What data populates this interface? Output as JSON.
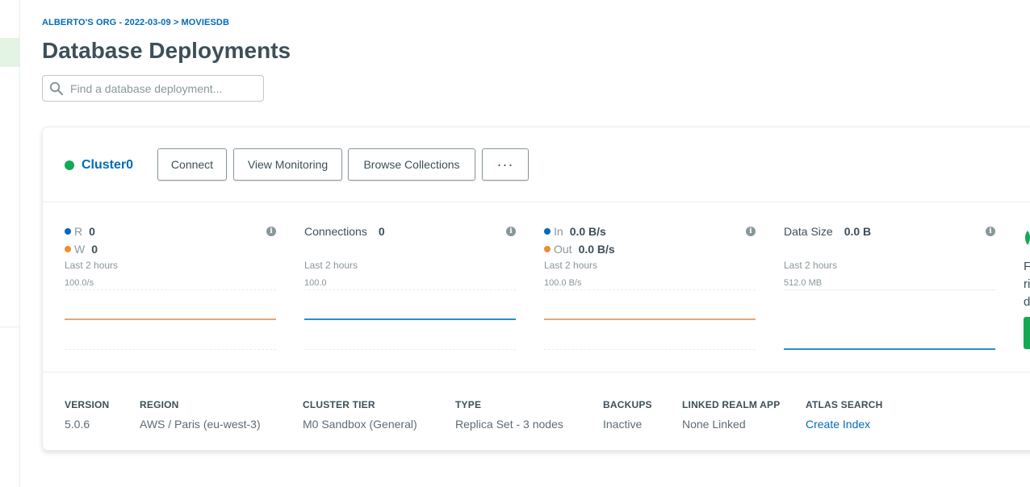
{
  "breadcrumb": "ALBERTO'S ORG - 2022-03-09 > MOVIESDB",
  "page_title": "Database Deployments",
  "search": {
    "placeholder": "Find a database deployment..."
  },
  "cluster": {
    "name": "Cluster0",
    "status_color": "#13aa52",
    "buttons": {
      "connect": "Connect",
      "view_monitoring": "View Monitoring",
      "browse_collections": "Browse Collections",
      "more": "···"
    }
  },
  "metrics": {
    "rw": {
      "r_label": "R",
      "r_value": "0",
      "r_color": "#016bb8",
      "w_label": "W",
      "w_value": "0",
      "w_color": "#f28b2c",
      "period": "Last 2 hours",
      "scale": "100.0/s",
      "line_color": "#e1a87a"
    },
    "connections": {
      "title": "Connections",
      "value": "0",
      "period": "Last 2 hours",
      "scale": "100.0",
      "line_color": "#2a8fbf"
    },
    "network": {
      "in_label": "In",
      "in_value": "0.0 B/s",
      "in_color": "#016bb8",
      "out_label": "Out",
      "out_value": "0.0 B/s",
      "out_color": "#f28b2c",
      "period": "Last 2 hours",
      "scale": "100.0 B/s",
      "line_color": "#e1a87a"
    },
    "data_size": {
      "title": "Data Size",
      "value": "0.0 B",
      "period": "Last 2 hours",
      "scale": "512.0 MB",
      "line_color": "#2a8fbf"
    },
    "info_icon": "info-icon"
  },
  "details": [
    {
      "label": "VERSION",
      "value": "5.0.6"
    },
    {
      "label": "REGION",
      "value": "AWS / Paris (eu-west-3)"
    },
    {
      "label": "CLUSTER TIER",
      "value": "M0 Sandbox (General)"
    },
    {
      "label": "TYPE",
      "value": "Replica Set - 3 nodes"
    },
    {
      "label": "BACKUPS",
      "value": "Inactive"
    },
    {
      "label": "LINKED REALM APP",
      "value": "None Linked"
    },
    {
      "label": "ATLAS SEARCH",
      "value": "Create Index"
    }
  ],
  "promo": {
    "lines": [
      "F",
      "ri",
      "d"
    ],
    "button_color": "#13aa52"
  }
}
